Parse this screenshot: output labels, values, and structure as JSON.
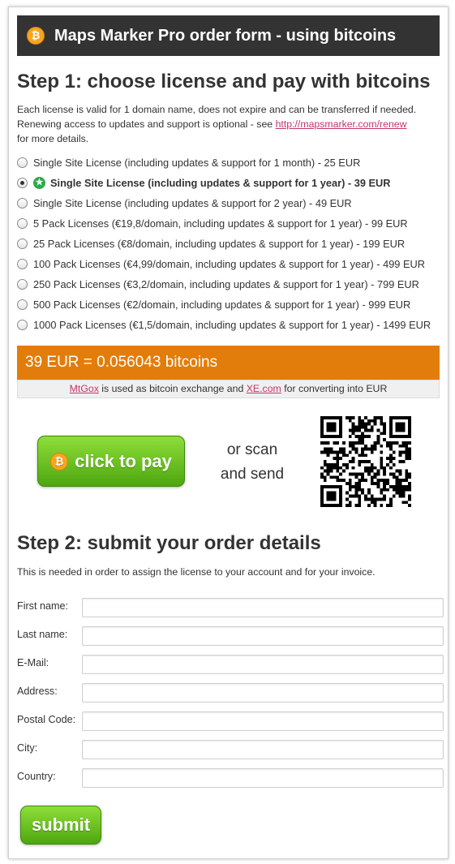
{
  "header": {
    "title": "Maps Marker Pro order form - using bitcoins",
    "icon": "bitcoin-icon"
  },
  "step1": {
    "title": "Step 1: choose license and pay with bitcoins",
    "desc_line1": "Each license is valid for 1 domain name, does not expire and can be transferred if needed.",
    "desc_line2": "Renewing access to updates and support is optional - see ",
    "renew_link": "http://mapsmarker.com/renew",
    "desc_line3": "for more details."
  },
  "licenses": [
    {
      "label": "Single Site License (including updates & support for 1 month) - 25 EUR",
      "selected": false
    },
    {
      "label": "Single Site License (including updates & support for 1 year) - 39 EUR",
      "selected": true
    },
    {
      "label": "Single Site License (including updates & support for 2 year) - 49 EUR",
      "selected": false
    },
    {
      "label": "5 Pack Licenses (€19,8/domain, including updates & support for 1 year) - 99 EUR",
      "selected": false
    },
    {
      "label": "25 Pack Licenses (€8/domain, including updates & support for 1 year) - 199 EUR",
      "selected": false
    },
    {
      "label": "100 Pack Licenses (€4,99/domain, including updates & support for 1 year) - 499 EUR",
      "selected": false
    },
    {
      "label": "250 Pack Licenses (€3,2/domain, including updates & support for 1 year) - 799 EUR",
      "selected": false
    },
    {
      "label": "500 Pack Licenses (€2/domain, including updates & support for 1 year) - 999 EUR",
      "selected": false
    },
    {
      "label": "1000 Pack Licenses (€1,5/domain, including updates & support for 1 year) - 1499 EUR",
      "selected": false
    }
  ],
  "price": {
    "text": "39 EUR = 0.056043 bitcoins"
  },
  "exchange": {
    "mtgox": "MtGox",
    "middle": " is used as bitcoin exchange and ",
    "xe": "XE.com",
    "end": " for converting into EUR"
  },
  "pay": {
    "button": "click to pay",
    "scan_line1": "or scan",
    "scan_line2": "and send"
  },
  "step2": {
    "title": "Step 2: submit your order details",
    "desc": "This is needed in order to assign the license to your account and for your invoice."
  },
  "form": {
    "fields": [
      {
        "label": "First name:",
        "value": ""
      },
      {
        "label": "Last name:",
        "value": ""
      },
      {
        "label": "E-Mail:",
        "value": ""
      },
      {
        "label": "Address:",
        "value": ""
      },
      {
        "label": "Postal Code:",
        "value": ""
      },
      {
        "label": "City:",
        "value": ""
      },
      {
        "label": "Country:",
        "value": ""
      }
    ],
    "submit": "submit"
  },
  "colors": {
    "header_bg": "#333333",
    "price_bar": "#e27d0b",
    "button_green": "#5bb318",
    "link": "#c2366c"
  }
}
